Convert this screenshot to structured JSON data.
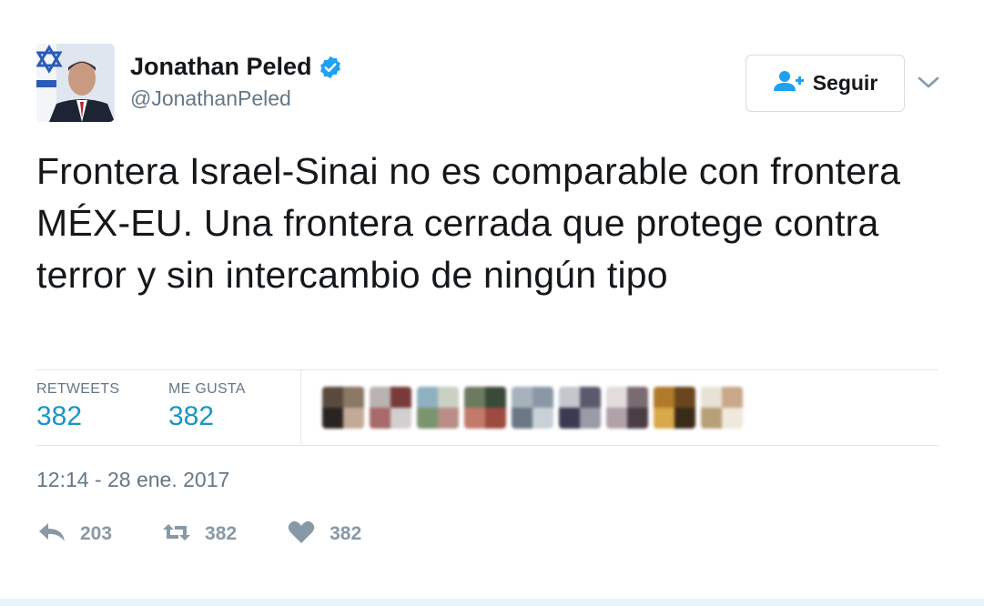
{
  "author": {
    "display_name": "Jonathan Peled",
    "handle": "@JonathanPeled",
    "verified": true
  },
  "follow_button": {
    "label": "Seguir"
  },
  "tweet": {
    "text": "Frontera Israel-Sinai no es comparable con frontera MÉX-EU. Una frontera cerrada que protege contra terror y sin intercambio de ningún tipo"
  },
  "stats": {
    "retweets_label": "RETWEETS",
    "retweets_value": "382",
    "likes_label": "ME GUSTA",
    "likes_value": "382"
  },
  "timestamp": "12:14 - 28 ene. 2017",
  "actions": {
    "reply_count": "203",
    "retweet_count": "382",
    "like_count": "382"
  },
  "colors": {
    "accent": "#1b95c0",
    "verified": "#1da1f2",
    "muted": "#657786",
    "action_gray": "#8899a6"
  }
}
